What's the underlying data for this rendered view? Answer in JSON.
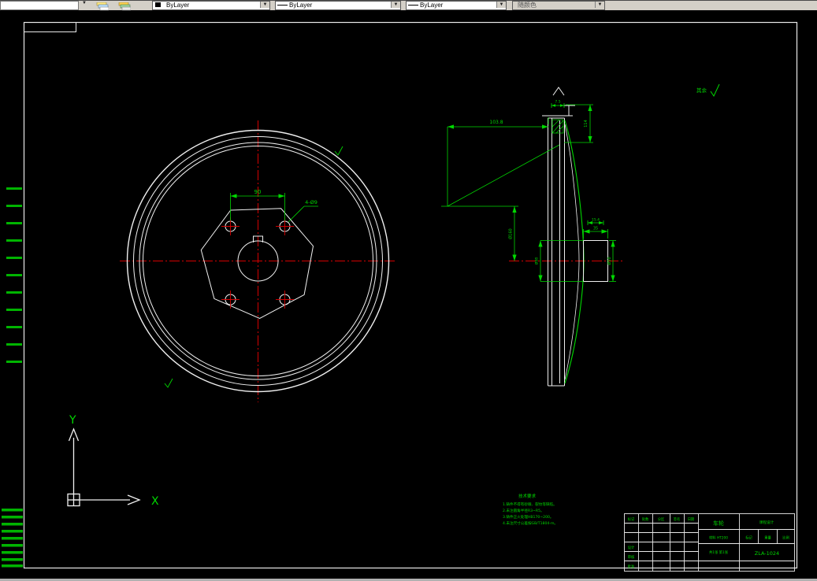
{
  "toolbar": {
    "color_combo": "ByLayer",
    "linetype_combo": "ByLayer",
    "lineweight_combo": "ByLayer",
    "plotstyle_combo": "随颜色"
  },
  "ucs": {
    "x": "X",
    "y": "Y"
  },
  "front_view": {
    "bolt_spacing_dim": "90",
    "bolt_hole_callout": "4-Ø9"
  },
  "side_view": {
    "overall_width_dim": "103.8",
    "rim_height_dim": "114",
    "rim_step_dim": "15.4",
    "hub_length_dim": "35",
    "hub_bore_dim": "Ø50",
    "hub_boss_dim": "Ø98",
    "web_dia_dim": "Ø160",
    "lip_dim": "7.5"
  },
  "finish": {
    "rest_label": "其余"
  },
  "notes": {
    "title": "技术要求",
    "lines": [
      "1.铸件不得有砂眼、裂纹等缺陷。",
      "2.未注圆角半径R3~R5。",
      "3.铸件正火处理HB170~200。",
      "4.未注尺寸公差按GB/T1804-m。"
    ]
  },
  "titleblock": {
    "part_name": "车轮",
    "org": "课程设计",
    "material": "材料 HT200",
    "stage": "标记",
    "weight": "重量",
    "ratio": "比例",
    "sheet": "共1张 第1张",
    "drawing_no": "ZLA-1024",
    "rev_headers": [
      "标记",
      "处数",
      "分区",
      "签名",
      "日期"
    ],
    "sign_rows": [
      "设计",
      "审核",
      "批准"
    ]
  },
  "colors": {
    "dimension_green": "#00d800",
    "centerline_red": "#d40000",
    "entity_white": "#f0f0f0"
  }
}
